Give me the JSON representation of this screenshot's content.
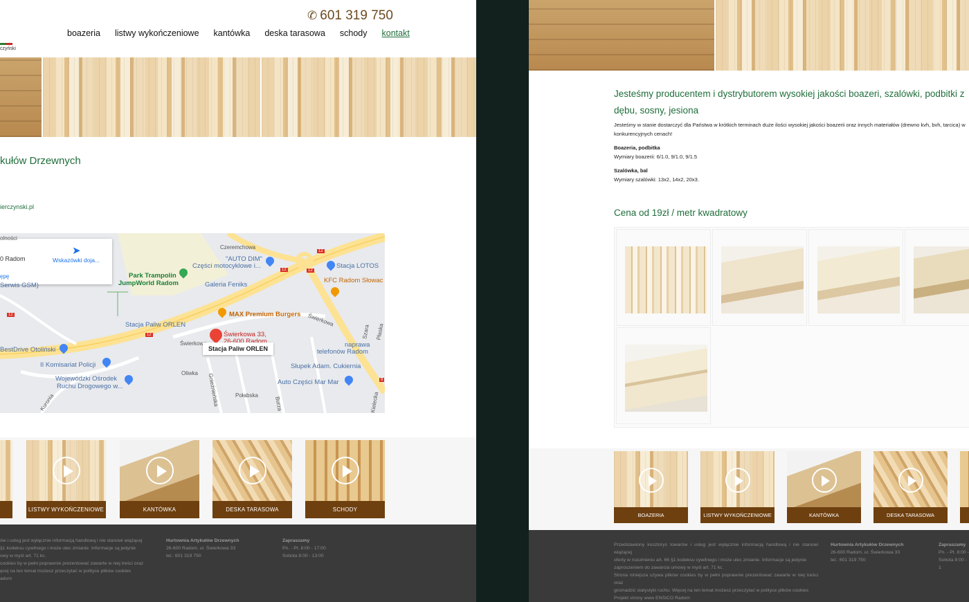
{
  "left": {
    "phone": "601 319 750",
    "nav": [
      {
        "label": "boazeria"
      },
      {
        "label": "listwy wykończeniowe"
      },
      {
        "label": "kantówka"
      },
      {
        "label": "deska tarasowa"
      },
      {
        "label": "schody"
      },
      {
        "label": "kontakt",
        "active": true
      }
    ],
    "logo_text": "czyński",
    "title": "kułów Drzewnych",
    "email": "ierczynski.pl",
    "map": {
      "card_address": "0 Radom",
      "card_directions": "Wskazówki doja...",
      "card_more": "ępę",
      "labels": {
        "park": "Park Trampolin",
        "park2": "JumpWorld Radom",
        "autodim": "\"AUTO DIM\"",
        "autodim2": "Części motocyklowe i...",
        "lotos": "Stacja LOTOS",
        "kfc": "KFC Radom Słowac",
        "feniks": "Galeria Feniks",
        "max": "MAX Premium Burgers",
        "orlen": "Stacja Paliw ORLEN",
        "swierkowa": "Świerkowa 33,",
        "swierkowa2": "26-600 Radom",
        "naprawa": "naprawa",
        "naprawa2": "telefonów Radom",
        "slupek": "Słupek Adam. Cukiernia",
        "bestdrive": "BestDrive Otoliński",
        "komisariat": "II Komisariat Policji",
        "wodr": "Wojewódzki Ośrodek",
        "wodr2": "Ruchu Drogowego w...",
        "marmar": "Auto Części Mar Mar",
        "serwis": "Serwis GSM)",
        "kuronia": "Kuronia",
        "czeremchowa": "Czeremchowa",
        "street_swierkowa": "Świerkowa",
        "street_swierkowa2": "Świerkowa",
        "oliwka": "Oliwka",
        "polabska": "Połabska",
        "gnieznienska": "Gnieźnieńska",
        "szara": "Szara",
        "plaska": "Płaska",
        "kielecka": "Kielecka",
        "burza": "Burza",
        "wolnosc": "olności"
      },
      "infobox": "Stacja Paliw ORLEN",
      "route_numbers": [
        "12",
        "12",
        "12",
        "12",
        "9",
        "12"
      ]
    },
    "tiles": [
      {
        "label": ""
      },
      {
        "label": "LISTWY WYKOŃCZENIOWE"
      },
      {
        "label": "KANTÓWKA"
      },
      {
        "label": "DESKA TARASOWA"
      },
      {
        "label": "SCHODY"
      }
    ],
    "footer": {
      "col1": [
        "ów i usług jest wyłącznie informacją handlową i nie stanowi wiążącej",
        "§1 kodeksu cywilnego i może ulec zmianie. Informacje są jedynie",
        "owy w myśl art. 71 kc.",
        "cookies by w pełni poprawnie prezentować zawarte w niej treści oraz",
        "ęcej na ten temat możesz przeczytać w polityce plików cookies",
        "adom"
      ],
      "col2_title": "Hurtownia Artykułów Drzewnych",
      "col2": [
        "26-600 Radom, ul. Świerkowa 33",
        "tel.: 601 319 750"
      ],
      "col3_title": "Zapraszamy",
      "col3": [
        "Pn. - Pt. 8:00 - 17:00",
        "Sobota 8:00 - 13:00"
      ]
    }
  },
  "right": {
    "headline": "Jesteśmy producentem i dystrybutorem wysokiej jakości boazeri, szalówki, podbitki z dębu, sosny, jesiona",
    "intro": "Jesteśmy w stanie dostarczyć dla Państwa w krótkich terminach duże ilości wysokiej jakości boazerii oraz innych materiałów (drewno kvh, bvh, tarcica) w konkurencyjnych cenach!",
    "section1_title": "Boazeria, podbitka",
    "section1_text": "Wymiary boazerii:  6/1.0,  9/1.0, 9/1.5",
    "section2_title": "Szalówka, bal",
    "section2_text": "Wymiary szalówki:  13x2, 14x2, 20x3.",
    "price": "Cena od 19zł / metr kwadratowy",
    "tiles": [
      {
        "label": "BOAZERIA"
      },
      {
        "label": "LISTWY WYKOŃCZENIOWE"
      },
      {
        "label": "KANTÓWKA"
      },
      {
        "label": "DESKA TARASOWA"
      },
      {
        "label": ""
      }
    ],
    "footer": {
      "col1": [
        "Przedstawiony kosztorys towarów i usług jest wyłącznie informacją handlową i nie stanowi wiążącej",
        "oferty w rozumieniu art. 66 §1 kodeksu cywilnego i może ulec zmianie. Informacje są jedynie",
        "zaproszeniem do zawarcia umowy w myśl art. 71 kc.",
        "Strona niniejsza używa plików cookies by w pełni poprawnie prezentować zawarte w niej treści oraz",
        "gromadzić statystyki ruchu. Więcej na ten temat możesz przeczytać w polityce plików cookies",
        "Projekt strony www ENSICO Radom"
      ],
      "col2_title": "Hurtownia Artykułów Drzewnych",
      "col2": [
        "26-600 Radom, ul. Świerkowa 33",
        "tel.: 601 319 750"
      ],
      "col3_title": "Zapraszamy",
      "col3": [
        "Pn. - Pt. 8:00 -",
        "Sobota 8:00 - 1"
      ]
    }
  },
  "colors": {
    "brand_green": "#1f6e3a",
    "brand_brown": "#6e3f0f",
    "footer_bg": "#3a3a3a",
    "phone_brown": "#6b4a1f"
  }
}
